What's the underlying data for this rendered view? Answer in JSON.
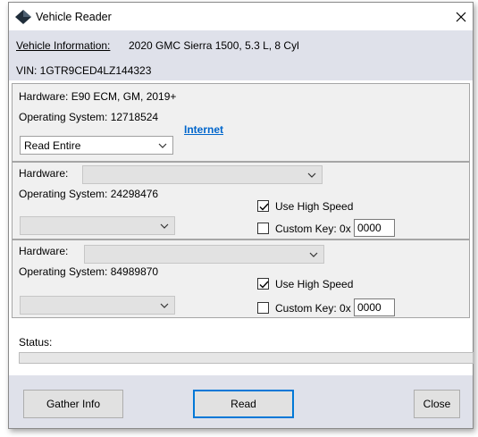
{
  "window": {
    "title": "Vehicle Reader",
    "close_glyph": "×"
  },
  "vehicle": {
    "info_label": "Vehicle Information:",
    "info_value": "2020 GMC Sierra 1500, 5.3 L, 8 Cyl",
    "vin": "VIN: 1GTR9CED4LZ144323"
  },
  "module1": {
    "hardware": "Hardware: E90 ECM, GM, 2019+",
    "os": "Operating System: 12718524",
    "link": "Internet",
    "read_mode": "Read Entire"
  },
  "module2": {
    "hardware_label": "Hardware:",
    "os": "Operating System: 24298476",
    "use_high_speed_label": "Use High Speed",
    "use_high_speed_checked": true,
    "custom_key_label": "Custom Key: 0x",
    "custom_key_checked": false,
    "custom_key_value": "0000"
  },
  "module3": {
    "hardware_label": "Hardware:",
    "os": "Operating System: 84989870",
    "use_high_speed_label": "Use High Speed",
    "use_high_speed_checked": true,
    "custom_key_label": "Custom Key: 0x",
    "custom_key_checked": false,
    "custom_key_value": "0000"
  },
  "status": {
    "label": "Status:",
    "progress": 0
  },
  "buttons": {
    "gather": "Gather Info",
    "read": "Read",
    "close": "Close"
  },
  "icons": {
    "app": "diamond-app-icon",
    "close": "close-icon",
    "dropdown": "chevron-down-icon",
    "check": "checkmark-icon"
  },
  "colors": {
    "band": "#dfe1ea",
    "panel": "#f0f0f0",
    "link": "#0066cc",
    "default_button_border": "#0078d7"
  }
}
